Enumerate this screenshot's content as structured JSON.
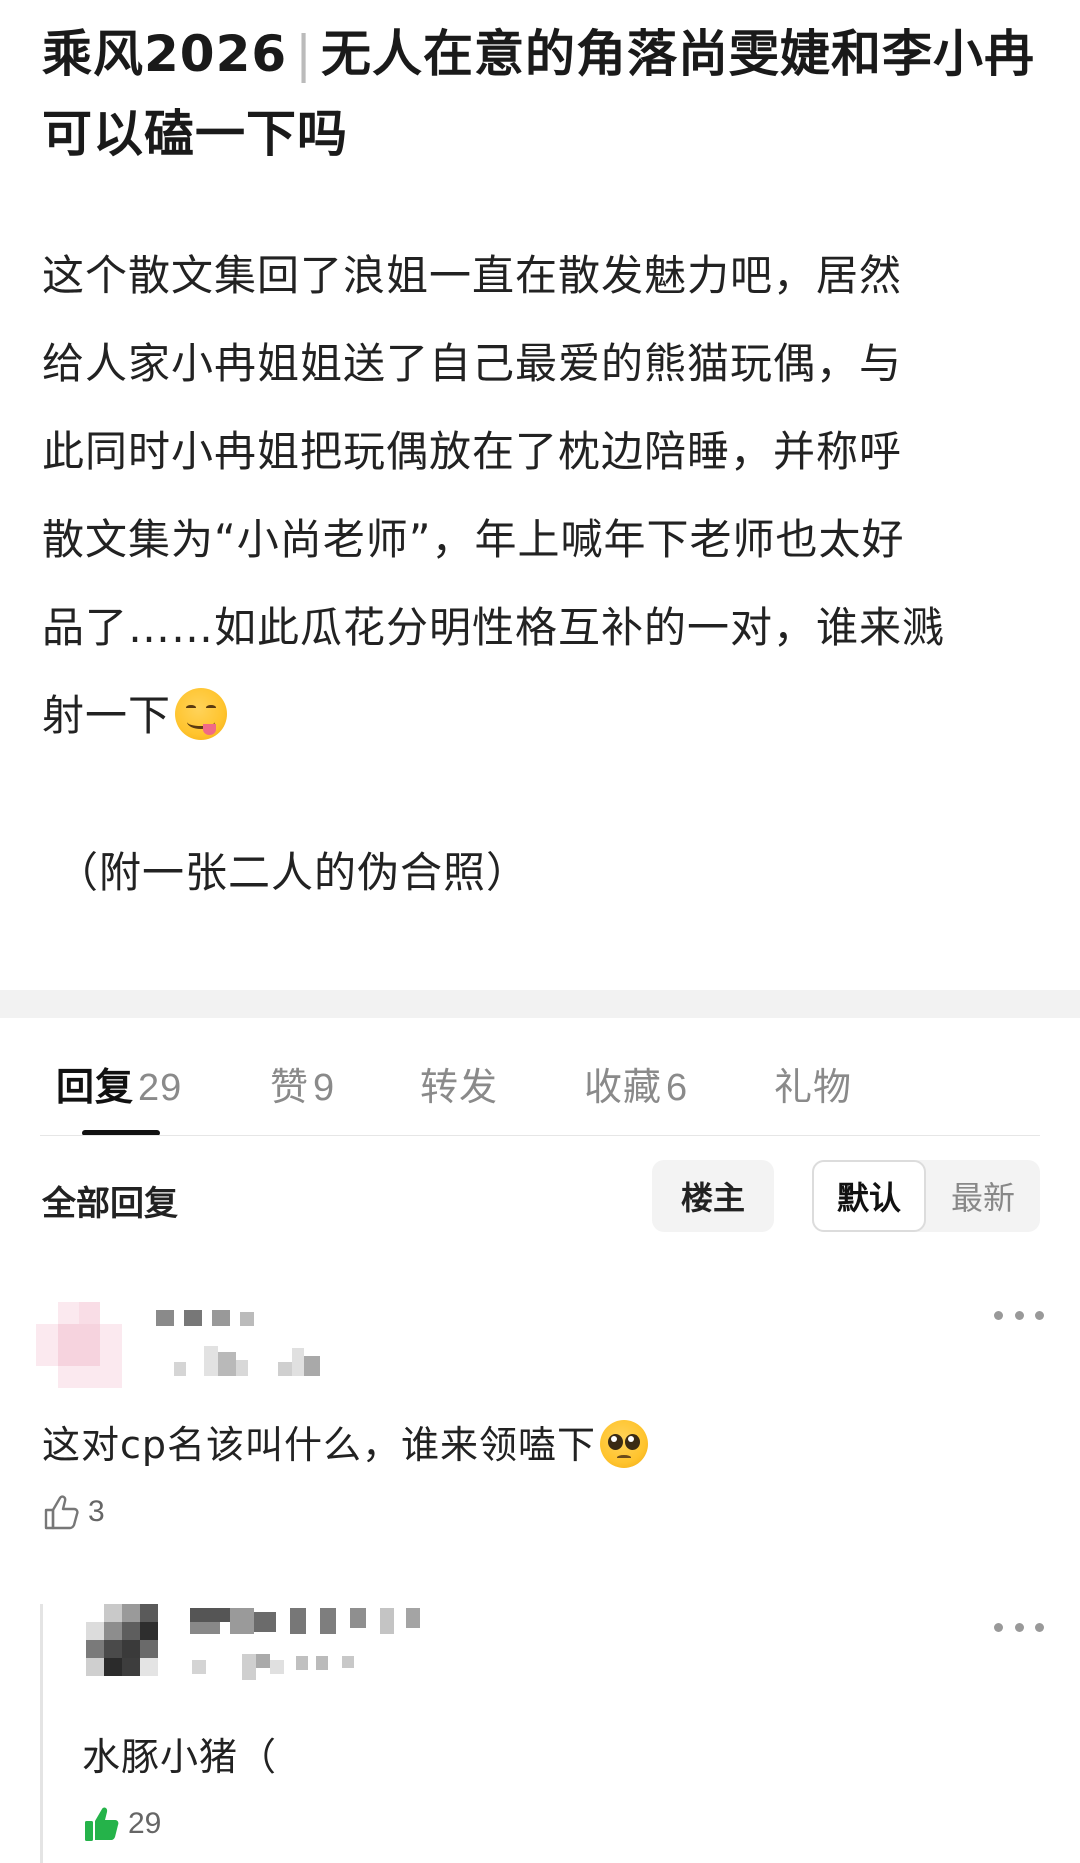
{
  "post": {
    "title_prefix": "乘风2026",
    "title_separator": "|",
    "title_rest": "无人在意的角落尚雯婕和李小冉可以磕一下吗",
    "body_lines": [
      "这个散文集回了浪姐一直在散发魅力吧，居然",
      "给人家小冉姐姐送了自己最爱的熊猫玩偶，与",
      "此同时小冉姐把玩偶放在了枕边陪睡，并称呼",
      "散文集为“小尚老师”，年上喊年下老师也太好",
      "品了……如此瓜花分明性格互补的一对，谁来溅",
      "射一下"
    ],
    "body_emoji": "yum-face-emoji",
    "note": "（附一张二人的伪合照）"
  },
  "tabs": [
    {
      "label": "回复",
      "count": "29",
      "active": true
    },
    {
      "label": "赞",
      "count": "9",
      "active": false
    },
    {
      "label": "转发",
      "count": "",
      "active": false
    },
    {
      "label": "收藏",
      "count": "6",
      "active": false
    },
    {
      "label": "礼物",
      "count": "",
      "active": false
    }
  ],
  "filter": {
    "all_replies": "全部回复",
    "op_only": "楼主",
    "sort_default": "默认",
    "sort_newest": "最新"
  },
  "comments": [
    {
      "text": "这对cp名该叫什么，谁来领嗑下",
      "emoji": "pleading-face-emoji",
      "likes": "3",
      "liked": false
    },
    {
      "text": "水豚小猪（",
      "likes": "29",
      "liked": true
    }
  ],
  "colors": {
    "liked_green": "#25b34a",
    "muted_gray": "#8a8a8a"
  }
}
